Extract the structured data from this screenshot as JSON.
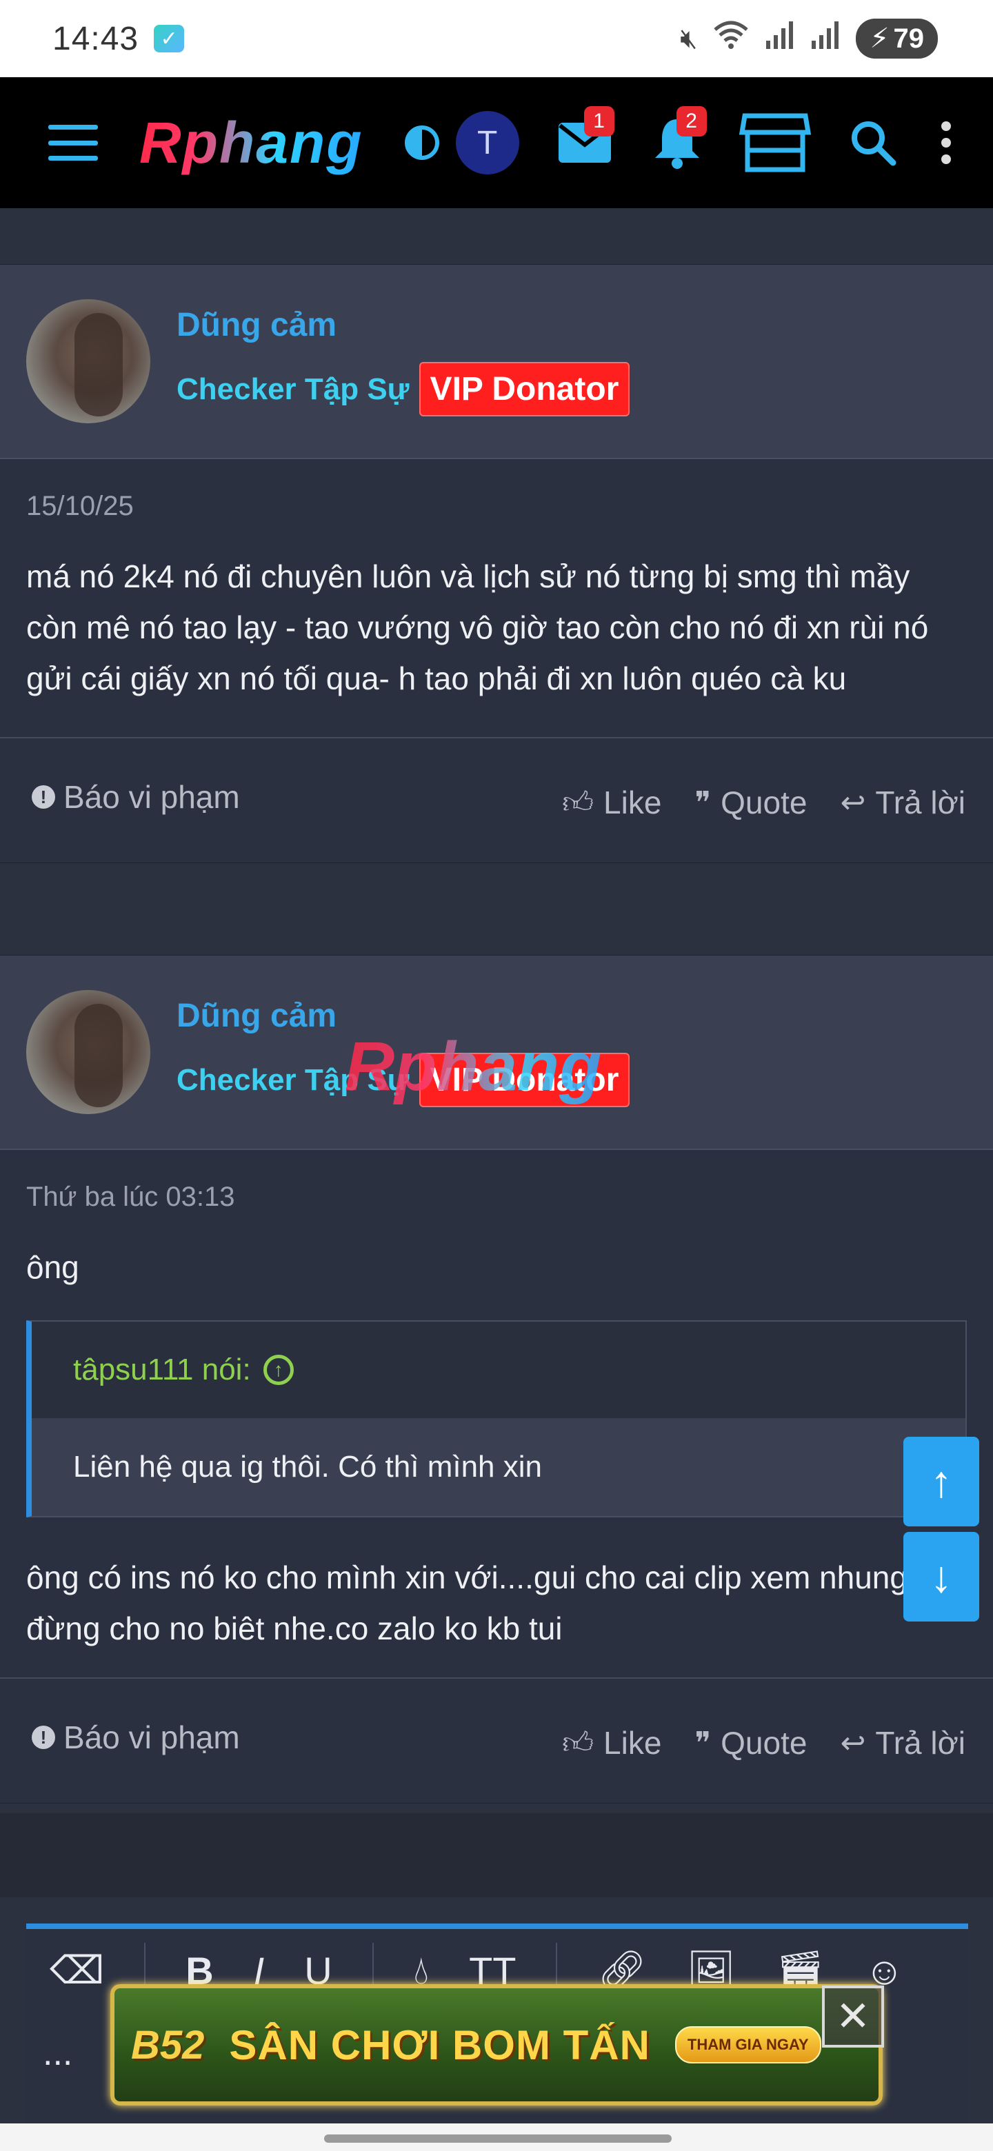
{
  "status_bar": {
    "time": "14:43",
    "battery": "79",
    "icons": [
      "mute-icon",
      "wifi-icon",
      "signal-icon",
      "signal-icon-2",
      "battery-icon"
    ]
  },
  "navbar": {
    "logo": "Rphang",
    "avatar_letter": "T",
    "messages_badge": "1",
    "notifications_badge": "2",
    "icons": [
      "menu-icon",
      "contrast-icon",
      "mail-icon",
      "bell-icon",
      "store-icon",
      "search-icon",
      "more-vertical-icon"
    ]
  },
  "posts": [
    {
      "username": "Dũng cảm",
      "user_title": "Checker Tập Sự",
      "badge": "VIP Donator",
      "date": "15/10/25",
      "text": "má nó 2k4 nó đi chuyên luôn và lịch sử nó từng bị smg thì mầy còn mê nó tao lạy - tao vướng vô giờ tao còn cho nó đi xn rùi nó gửi cái giấy xn nó tối qua- h tao phải đi xn luôn quéo cà ku",
      "report_label": "Báo vi phạm",
      "like_label": "Like",
      "quote_label": "Quote",
      "reply_label": "Trả lời"
    },
    {
      "username": "Dũng cảm",
      "user_title": "Checker Tập Sự",
      "badge": "VIP Donator",
      "date": "Thứ ba lúc 03:13",
      "text_before_quote": "ông",
      "quote_author": "tâpsu111 nói:",
      "quote_text": "Liên hệ qua ig thôi. Có thì mình xin",
      "text_after_quote": "ông có ins nó ko cho mình xin với....gui cho cai clip xem nhung đừng cho no biêt nhe.co zalo ko kb tui",
      "report_label": "Báo vi phạm",
      "like_label": "Like",
      "quote_label": "Quote",
      "reply_label": "Trả lời"
    }
  ],
  "watermark": "Rphang",
  "editor": {
    "toolbar": [
      "eraser-icon",
      "B",
      "I",
      "U",
      "ink-drop-icon",
      "TT",
      "link-icon",
      "image-icon",
      "video-add-icon",
      "emoji-icon"
    ],
    "more": "..."
  },
  "ad": {
    "logo": "B52",
    "title": "SÂN CHƠI BOM TẤN",
    "cta": "THAM GIA NGAY",
    "close": "✕"
  }
}
